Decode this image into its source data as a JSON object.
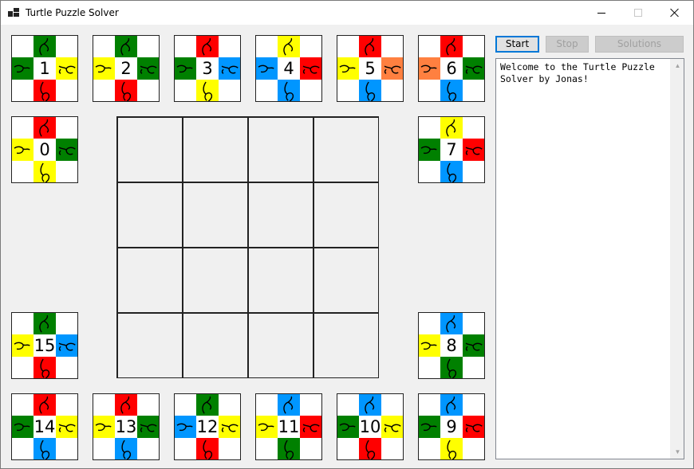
{
  "window": {
    "title": "Turtle Puzzle Solver"
  },
  "buttons": {
    "start": "Start",
    "stop": "Stop",
    "solutions": "Solutions"
  },
  "log": {
    "text": "Welcome to the Turtle Puzzle\nSolver by Jonas!"
  },
  "colors": {
    "R": "#ff0000",
    "G": "#008000",
    "Y": "#ffff00",
    "B": "#0096ff",
    "O": "#ff8040"
  },
  "board": {
    "rows": 4,
    "cols": 4,
    "filled": []
  },
  "tiles": [
    {
      "id": "0",
      "top": "R",
      "right": "G",
      "bottom": "Y",
      "left": "Y"
    },
    {
      "id": "1",
      "top": "G",
      "right": "Y",
      "bottom": "R",
      "left": "G"
    },
    {
      "id": "2",
      "top": "G",
      "right": "G",
      "bottom": "R",
      "left": "Y"
    },
    {
      "id": "3",
      "top": "R",
      "right": "B",
      "bottom": "Y",
      "left": "G"
    },
    {
      "id": "4",
      "top": "Y",
      "right": "R",
      "bottom": "B",
      "left": "B"
    },
    {
      "id": "5",
      "top": "R",
      "right": "O",
      "bottom": "B",
      "left": "Y"
    },
    {
      "id": "6",
      "top": "R",
      "right": "G",
      "bottom": "B",
      "left": "O"
    },
    {
      "id": "7",
      "top": "Y",
      "right": "R",
      "bottom": "B",
      "left": "G"
    },
    {
      "id": "8",
      "top": "B",
      "right": "G",
      "bottom": "G",
      "left": "Y"
    },
    {
      "id": "9",
      "top": "B",
      "right": "R",
      "bottom": "Y",
      "left": "G"
    },
    {
      "id": "10",
      "top": "B",
      "right": "Y",
      "bottom": "R",
      "left": "G"
    },
    {
      "id": "11",
      "top": "B",
      "right": "R",
      "bottom": "G",
      "left": "Y"
    },
    {
      "id": "12",
      "top": "G",
      "right": "Y",
      "bottom": "R",
      "left": "B"
    },
    {
      "id": "13",
      "top": "R",
      "right": "G",
      "bottom": "B",
      "left": "Y"
    },
    {
      "id": "14",
      "top": "R",
      "right": "Y",
      "bottom": "B",
      "left": "G"
    },
    {
      "id": "15",
      "top": "G",
      "right": "B",
      "bottom": "R",
      "left": "Y"
    }
  ]
}
